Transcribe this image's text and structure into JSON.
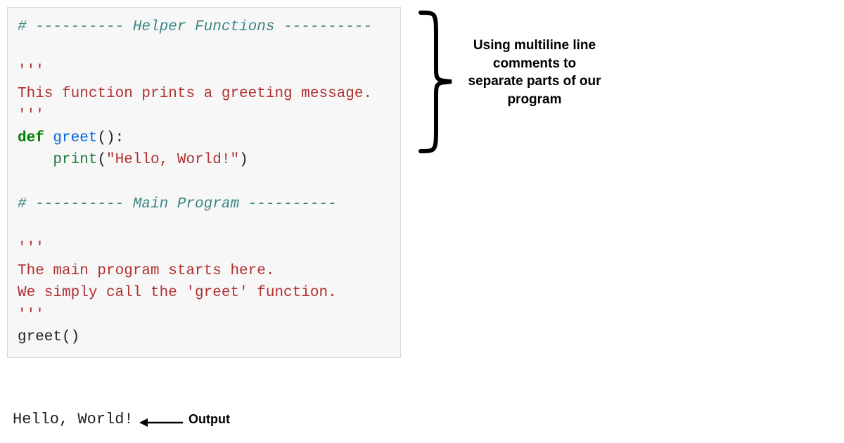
{
  "code": {
    "section1_prefix": "# ---------- ",
    "section1_title": "Helper Functions",
    "section1_suffix": " ----------",
    "triple1_open": "'''",
    "doc1_line": "This function prints a greeting message.",
    "triple1_close": "'''",
    "def_kw": "def",
    "space1": " ",
    "func_name": "greet",
    "def_parens": "():",
    "indent": "    ",
    "print_name": "print",
    "open_paren": "(",
    "hello_string": "\"Hello, World!\"",
    "close_paren": ")",
    "section2_prefix": "# ---------- ",
    "section2_title": "Main Program",
    "section2_suffix": " ----------",
    "triple2_open": "'''",
    "doc2_line1": "The main program starts here.",
    "doc2_line2": "We simply call the 'greet' function.",
    "triple2_close": "'''",
    "call_name": "greet",
    "call_parens": "()"
  },
  "output": {
    "text": "Hello, World!",
    "label": "Output"
  },
  "annotation": {
    "text": "Using multiline line comments to separate parts of our program"
  }
}
